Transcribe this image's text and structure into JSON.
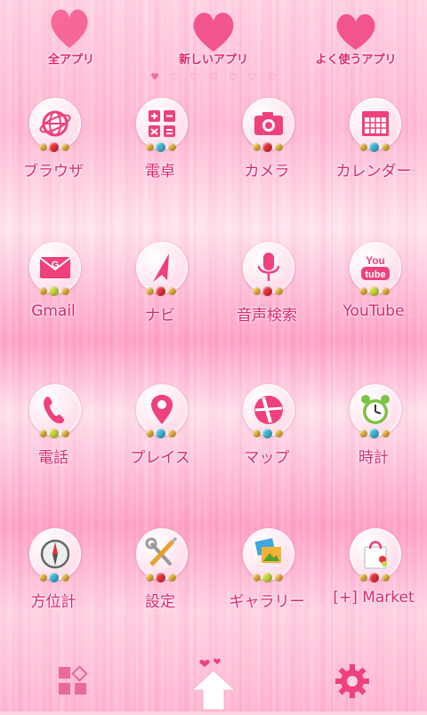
{
  "tabs": [
    {
      "label": "全アプリ"
    },
    {
      "label": "新しいアプリ"
    },
    {
      "label": "よく使うアプリ"
    }
  ],
  "page_indicator": {
    "active_symbol": "♥",
    "inactive_symbol": "♡",
    "count": 7,
    "active_index": 0
  },
  "apps": [
    {
      "label": "ブラウザ",
      "icon": "globe-icon",
      "bead": "#e8303a"
    },
    {
      "label": "電卓",
      "icon": "calculator-icon",
      "bead": "#3fb7d8"
    },
    {
      "label": "カメラ",
      "icon": "camera-icon",
      "bead": "#e8303a"
    },
    {
      "label": "カレンダー",
      "icon": "calendar-icon",
      "bead": "#3fb7d8"
    },
    {
      "label": "Gmail",
      "icon": "mail-icon",
      "bead": "#c7d836"
    },
    {
      "label": "ナビ",
      "icon": "navigation-arrow-icon",
      "bead": "#e8303a"
    },
    {
      "label": "音声検索",
      "icon": "microphone-icon",
      "bead": "#e8303a"
    },
    {
      "label": "YouTube",
      "icon": "youtube-icon",
      "bead": "#c7d836"
    },
    {
      "label": "電話",
      "icon": "phone-icon",
      "bead": "#c7d836"
    },
    {
      "label": "プレイス",
      "icon": "map-pin-icon",
      "bead": "#3fb7d8"
    },
    {
      "label": "マップ",
      "icon": "road-sign-icon",
      "bead": "#3fb7d8"
    },
    {
      "label": "時計",
      "icon": "alarm-clock-icon",
      "bead": "#3fb7d8"
    },
    {
      "label": "方位計",
      "icon": "compass-icon",
      "bead": "#3fb7d8"
    },
    {
      "label": "設定",
      "icon": "tools-icon",
      "bead": "#e8303a"
    },
    {
      "label": "ギャラリー",
      "icon": "photos-icon",
      "bead": "#c7d836"
    },
    {
      "label": "[+] Market",
      "icon": "shopping-bag-icon",
      "bead": "#e8303a"
    }
  ],
  "dock": {
    "left_icon": "grid-widgets-icon",
    "center_icon": "home-icon",
    "right_icon": "gear-icon"
  },
  "colors": {
    "accent": "#e0246e",
    "icon_pink": "#f0407e"
  }
}
